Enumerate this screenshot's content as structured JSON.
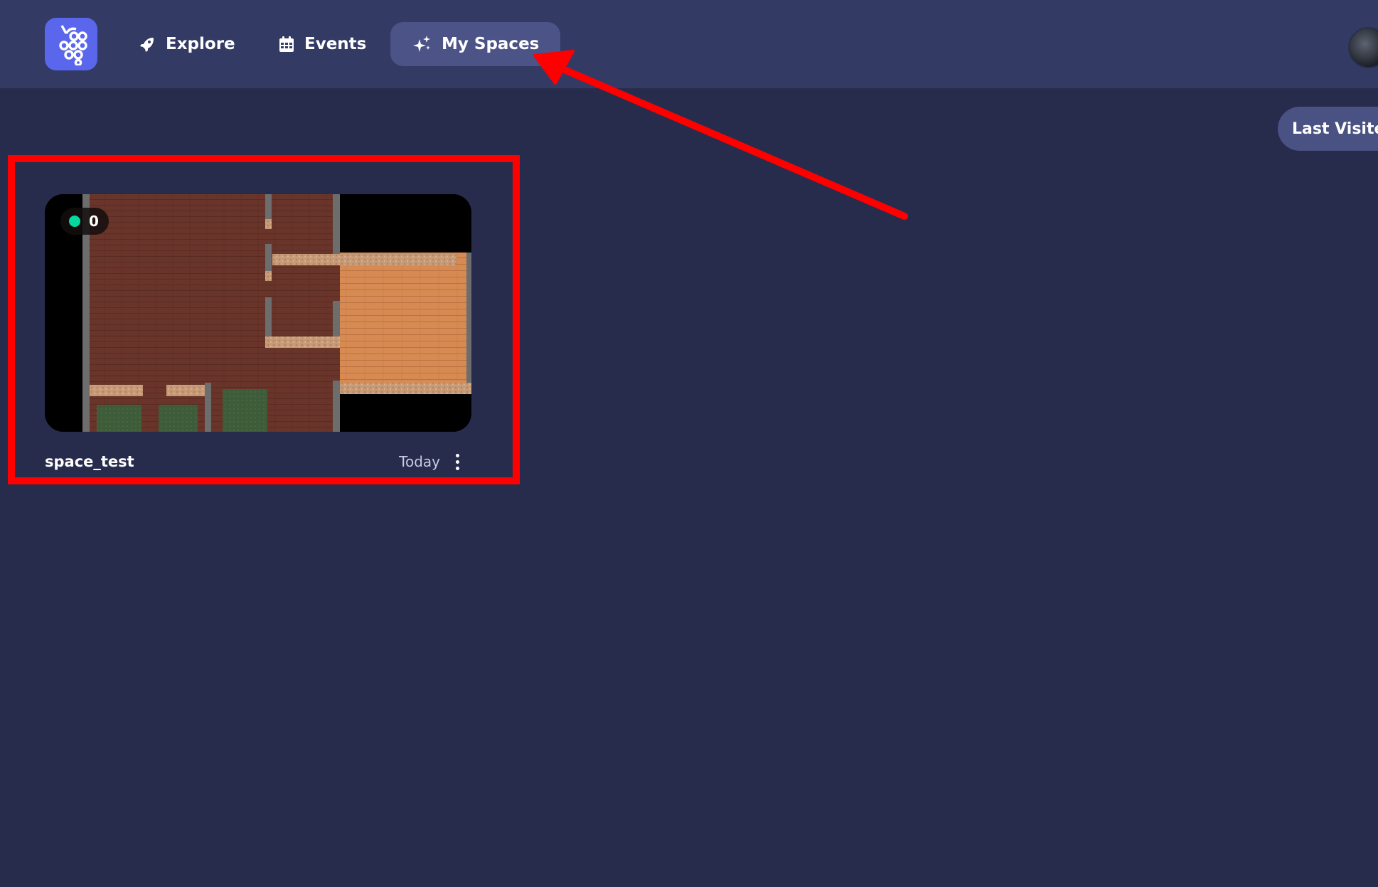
{
  "nav": {
    "logo_icon": "grapes-logo-icon",
    "items": [
      {
        "label": "Explore",
        "icon": "rocket-icon"
      },
      {
        "label": "Events",
        "icon": "calendar-icon"
      },
      {
        "label": "My Spaces",
        "icon": "sparkles-icon",
        "active": true
      }
    ]
  },
  "sort": {
    "label": "Last Visited"
  },
  "spaces": [
    {
      "name": "space_test",
      "online_count": "0",
      "last_visited": "Today",
      "status_color": "#06d6a0"
    }
  ],
  "colors": {
    "background": "#282c4c",
    "topbar": "#333a64",
    "active_nav": "#4b5387",
    "logo": "#5a67ec",
    "annotation": "#ff0000"
  }
}
